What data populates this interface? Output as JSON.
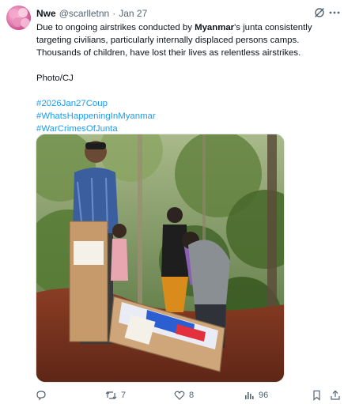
{
  "author": {
    "name": "Nwe",
    "handle": "@scarlletnn",
    "separator": "·",
    "date": "Jan 27"
  },
  "tweet": {
    "line1_pre": "Due to ongoing airstrikes conducted by ",
    "line1_bold": "Myanmar",
    "line1_post": "'s junta consistently",
    "line2": "targeting civilians, particularly internally displaced persons camps.",
    "line3": "Thousands of children, have lost their lives as relentless airstrikes.",
    "credit": "Photo/CJ",
    "hashtags": [
      "#2026Jan27Coup",
      "#WhatsHappeningInMyanmar",
      "#WarCrimesOfJunta"
    ]
  },
  "actions": {
    "replies": "",
    "reposts": "7",
    "likes": "8",
    "views": "96"
  },
  "icons": {
    "grok": "grok-icon",
    "more": "more-icon",
    "reply": "reply-icon",
    "repost": "repost-icon",
    "like": "like-icon",
    "views": "views-icon",
    "bookmark": "bookmark-icon",
    "share": "share-icon"
  },
  "colors": {
    "link": "#1d9bf0",
    "secondary_text": "#536471",
    "primary_text": "#0f1419"
  }
}
